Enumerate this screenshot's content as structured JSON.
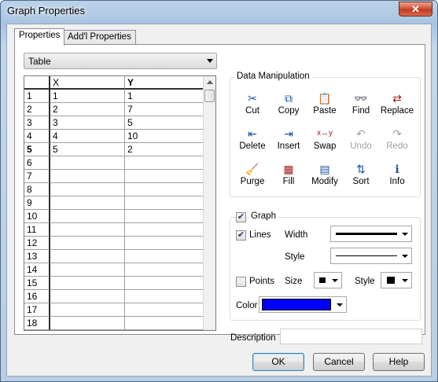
{
  "window": {
    "title": "Graph Properties",
    "close_label": "✕"
  },
  "tabs": [
    {
      "label": "Properties"
    },
    {
      "label": "Add'l Properties"
    }
  ],
  "table_dropdown": {
    "value": "Table"
  },
  "grid": {
    "headers": {
      "x": "X",
      "y": "Y"
    },
    "rows": [
      {
        "num": "1",
        "x": "1",
        "y": "1"
      },
      {
        "num": "2",
        "x": "2",
        "y": "7"
      },
      {
        "num": "3",
        "x": "3",
        "y": "5"
      },
      {
        "num": "4",
        "x": "4",
        "y": "10"
      },
      {
        "num": "5",
        "x": "5",
        "y": "2"
      },
      {
        "num": "6",
        "x": "",
        "y": ""
      },
      {
        "num": "7",
        "x": "",
        "y": ""
      },
      {
        "num": "8",
        "x": "",
        "y": ""
      },
      {
        "num": "9",
        "x": "",
        "y": ""
      },
      {
        "num": "10",
        "x": "",
        "y": ""
      },
      {
        "num": "11",
        "x": "",
        "y": ""
      },
      {
        "num": "12",
        "x": "",
        "y": ""
      },
      {
        "num": "13",
        "x": "",
        "y": ""
      },
      {
        "num": "14",
        "x": "",
        "y": ""
      },
      {
        "num": "15",
        "x": "",
        "y": ""
      },
      {
        "num": "16",
        "x": "",
        "y": ""
      },
      {
        "num": "17",
        "x": "",
        "y": ""
      },
      {
        "num": "18",
        "x": "",
        "y": ""
      }
    ],
    "current_row": "5"
  },
  "data_manipulation": {
    "label": "Data Manipulation",
    "tools": [
      {
        "label": "Cut",
        "icon": "scissors-icon",
        "glyph": "✂",
        "color": "#1a4fa0",
        "enabled": true
      },
      {
        "label": "Copy",
        "icon": "copy-icon",
        "glyph": "⧉",
        "color": "#1a4fa0",
        "enabled": true
      },
      {
        "label": "Paste",
        "icon": "paste-icon",
        "glyph": "📋",
        "color": "#6b4a12",
        "enabled": true
      },
      {
        "label": "Find",
        "icon": "binoculars-icon",
        "glyph": "👓",
        "color": "#222222",
        "enabled": true
      },
      {
        "label": "Replace",
        "icon": "replace-icon",
        "glyph": "⇄",
        "color": "#a01a1a",
        "enabled": true
      },
      {
        "label": "Delete",
        "icon": "delete-column-icon",
        "glyph": "⇤",
        "color": "#1a4fa0",
        "enabled": true
      },
      {
        "label": "Insert",
        "icon": "insert-column-icon",
        "glyph": "⇥",
        "color": "#1a4fa0",
        "enabled": true
      },
      {
        "label": "Swap",
        "icon": "swap-icon",
        "glyph": "x↔y",
        "color": "#a01a1a",
        "enabled": true
      },
      {
        "label": "Undo",
        "icon": "undo-icon",
        "glyph": "↶",
        "color": "#a0a0a0",
        "enabled": false
      },
      {
        "label": "Redo",
        "icon": "redo-icon",
        "glyph": "↷",
        "color": "#a0a0a0",
        "enabled": false
      },
      {
        "label": "Purge",
        "icon": "broom-icon",
        "glyph": "🧹",
        "color": "#8a6a1a",
        "enabled": true
      },
      {
        "label": "Fill",
        "icon": "fill-table-icon",
        "glyph": "▦",
        "color": "#a01a1a",
        "enabled": true
      },
      {
        "label": "Modify",
        "icon": "modify-table-icon",
        "glyph": "▤",
        "color": "#1a4fa0",
        "enabled": true
      },
      {
        "label": "Sort",
        "icon": "sort-icon",
        "glyph": "⇅",
        "color": "#1a4fa0",
        "enabled": true
      },
      {
        "label": "Info",
        "icon": "info-icon",
        "glyph": "ℹ",
        "color": "#1a4fa0",
        "enabled": true
      }
    ]
  },
  "graph": {
    "label": "Graph",
    "checked": true,
    "lines": {
      "label": "Lines",
      "checked": true,
      "width_label": "Width",
      "style_label": "Style"
    },
    "points": {
      "label": "Points",
      "checked": false,
      "size_label": "Size",
      "style_label": "Style"
    },
    "color": {
      "label": "Color",
      "value": "#0000ff"
    }
  },
  "description": {
    "label": "Description",
    "value": ""
  },
  "buttons": {
    "ok": "OK",
    "cancel": "Cancel",
    "help": "Help"
  }
}
